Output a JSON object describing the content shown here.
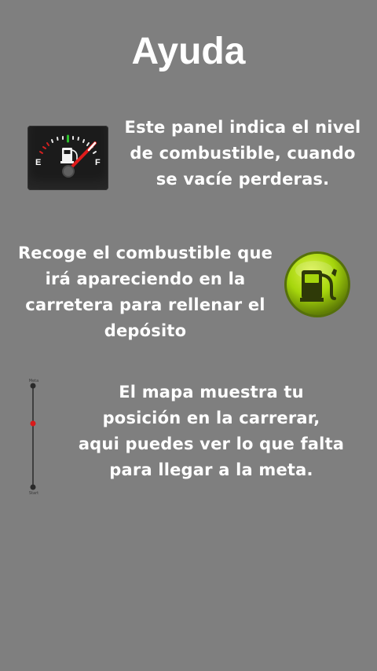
{
  "page": {
    "title": "Ayuda"
  },
  "sections": [
    {
      "text": "Este panel indica el nivel\nde combustible, cuando\nse vacíe perderas.",
      "icon": "fuel-gauge-icon"
    },
    {
      "text": "Recoge el combustible que\nirá apareciendo en la\ncarretera para rellenar el\ndepósito",
      "icon": "fuel-pump-icon"
    },
    {
      "text": "El mapa muestra tu\nposición en la carrerar,\naqui puedes ver lo que falta\npara llegar a la meta.",
      "icon": "progress-map-icon"
    }
  ],
  "gauge": {
    "empty_label": "E",
    "full_label": "F"
  },
  "minimap": {
    "top_label": "Meta",
    "bottom_label": "Start"
  },
  "colors": {
    "background": "#7f7f7f",
    "text": "#ffffff",
    "needle": "#e01b1b",
    "pump_green": "#a6d60c",
    "map_marker": "#d91a1a"
  }
}
